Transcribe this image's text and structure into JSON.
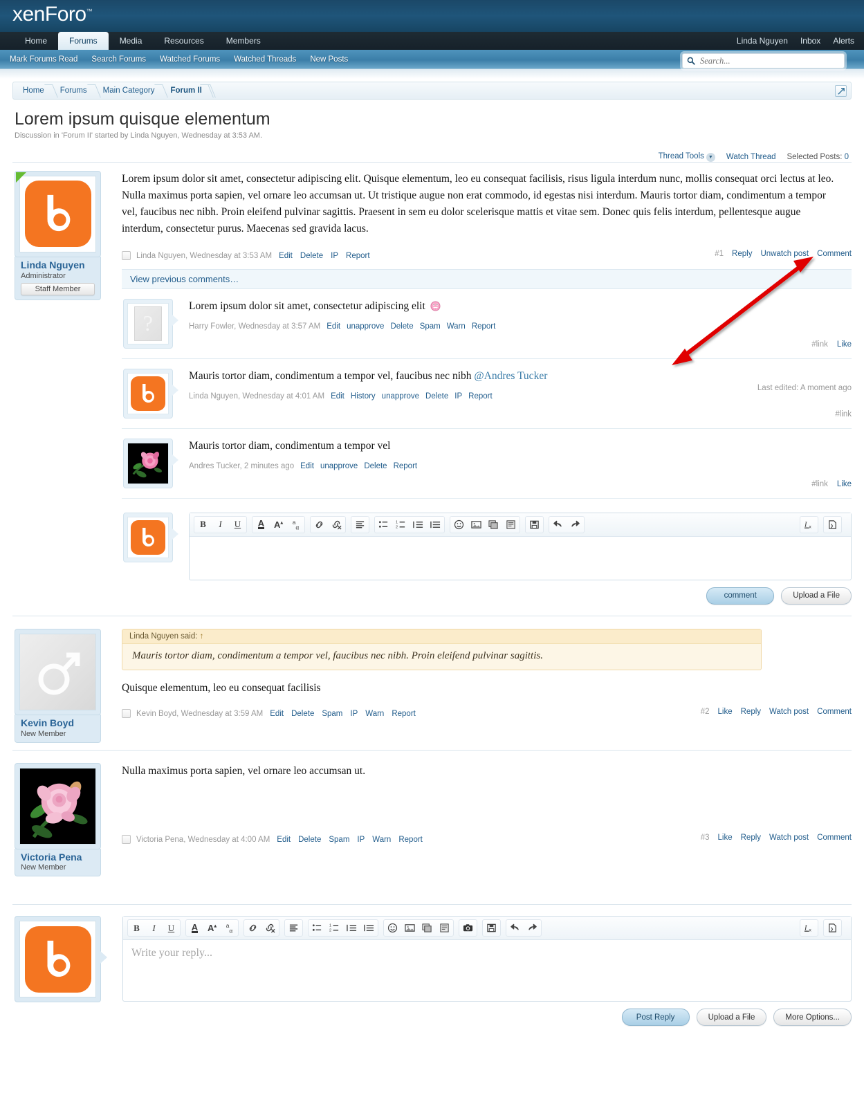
{
  "site": {
    "logo_text": "xenForo",
    "logo_tm": "™"
  },
  "nav": {
    "tabs": [
      {
        "label": "Home",
        "active": false
      },
      {
        "label": "Forums",
        "active": true
      },
      {
        "label": "Media",
        "active": false
      },
      {
        "label": "Resources",
        "active": false
      },
      {
        "label": "Members",
        "active": false
      }
    ],
    "right": [
      {
        "label": "Linda Nguyen"
      },
      {
        "label": "Inbox"
      },
      {
        "label": "Alerts"
      }
    ]
  },
  "subnav": {
    "items": [
      {
        "label": "Mark Forums Read"
      },
      {
        "label": "Search Forums"
      },
      {
        "label": "Watched Forums"
      },
      {
        "label": "Watched Threads"
      },
      {
        "label": "New Posts"
      }
    ],
    "search_placeholder": "Search..."
  },
  "breadcrumb": {
    "items": [
      {
        "label": "Home"
      },
      {
        "label": "Forums"
      },
      {
        "label": "Main Category"
      },
      {
        "label": "Forum II"
      }
    ]
  },
  "thread": {
    "title": "Lorem ipsum quisque elementum",
    "subtitle": "Discussion in 'Forum II' started by Linda Nguyen, Wednesday at 3:53 AM.",
    "tools": {
      "thread_tools": "Thread Tools",
      "watch_thread": "Watch Thread",
      "selected_posts_label": "Selected Posts:",
      "selected_posts_count": "0"
    }
  },
  "posts": [
    {
      "id": "post-1",
      "user": {
        "name": "Linda Nguyen",
        "title": "Administrator",
        "badge": "Staff Member",
        "avatar": "logo-b",
        "online": true
      },
      "body": "Lorem ipsum dolor sit amet, consectetur adipiscing elit. Quisque elementum, leo eu consequat facilisis, risus ligula interdum nunc, mollis consequat orci lectus at leo. Nulla maximus porta sapien, vel ornare leo accumsan ut. Ut tristique augue non erat commodo, id egestas nisi interdum. Mauris tortor diam, condimentum a tempor vel, faucibus nec nibh. Proin eleifend pulvinar sagittis. Praesent in sem eu dolor scelerisque mattis et vitae sem. Donec quis felis interdum, pellentesque augue interdum, consectetur purus. Maecenas sed gravida lacus.",
      "footer_meta": "Linda Nguyen, Wednesday at 3:53 AM",
      "footer_links": [
        "Edit",
        "Delete",
        "IP",
        "Report"
      ],
      "post_number": "#1",
      "right_links": [
        "Reply",
        "Unwatch post",
        "Comment"
      ]
    },
    {
      "id": "post-2",
      "user": {
        "name": "Kevin Boyd",
        "title": "New Member",
        "badge": null,
        "avatar": "gender-male",
        "online": false
      },
      "quote": {
        "header_name": "Linda Nguyen said:",
        "arrow": "↑",
        "text": "Mauris tortor diam, condimentum a tempor vel, faucibus nec nibh. Proin eleifend pulvinar sagittis."
      },
      "body": "Quisque elementum, leo eu consequat facilisis",
      "footer_meta": "Kevin Boyd, Wednesday at 3:59 AM",
      "footer_links": [
        "Edit",
        "Delete",
        "Spam",
        "IP",
        "Warn",
        "Report"
      ],
      "post_number": "#2",
      "right_links": [
        "Like",
        "Reply",
        "Watch post",
        "Comment"
      ]
    },
    {
      "id": "post-3",
      "user": {
        "name": "Victoria Pena",
        "title": "New Member",
        "badge": null,
        "avatar": "rose-photo",
        "online": false
      },
      "body": "Nulla maximus porta sapien, vel ornare leo accumsan ut.",
      "footer_meta": "Victoria Pena, Wednesday at 4:00 AM",
      "footer_links": [
        "Edit",
        "Delete",
        "Spam",
        "IP",
        "Warn",
        "Report"
      ],
      "post_number": "#3",
      "right_links": [
        "Like",
        "Reply",
        "Watch post",
        "Comment"
      ]
    }
  ],
  "comments": {
    "view_previous": "View previous comments…",
    "items": [
      {
        "avatar": "question-placeholder",
        "text": "Lorem ipsum dolor sit amet, consectetur adipiscing elit",
        "has_smiley": true,
        "meta": "Harry Fowler, Wednesday at 3:57 AM",
        "links": [
          "Edit",
          "unapprove",
          "Delete",
          "Spam",
          "Warn",
          "Report"
        ],
        "hash": "#link",
        "like": "Like",
        "last_edited": null
      },
      {
        "avatar": "logo-b",
        "text": "Mauris tortor diam, condimentum a tempor vel, faucibus nec nibh ",
        "mention": "@Andres Tucker",
        "has_smiley": false,
        "meta": "Linda Nguyen, Wednesday at 4:01 AM",
        "links": [
          "Edit",
          "History",
          "unapprove",
          "Delete",
          "IP",
          "Report"
        ],
        "hash": "#link",
        "like": null,
        "last_edited": "Last edited: A moment ago"
      },
      {
        "avatar": "rose-photo",
        "text": "Mauris tortor diam, condimentum a tempor vel",
        "has_smiley": false,
        "meta": "Andres Tucker, 2 minutes ago",
        "links": [
          "Edit",
          "unapprove",
          "Delete",
          "Report"
        ],
        "hash": "#link",
        "like": "Like",
        "last_edited": null
      }
    ]
  },
  "comment_editor": {
    "avatar": "logo-b",
    "placeholder": "",
    "buttons": [
      {
        "label": "comment",
        "primary": true
      },
      {
        "label": "Upload a File",
        "primary": false
      }
    ],
    "toolbar_groups": [
      {
        "icons": [
          "bold-icon",
          "italic-icon",
          "underline-icon"
        ]
      },
      {
        "icons": [
          "text-color-icon",
          "font-size-icon",
          "font-family-icon"
        ]
      },
      {
        "icons": [
          "link-icon",
          "unlink-icon"
        ]
      },
      {
        "icons": [
          "align-icon"
        ]
      },
      {
        "icons": [
          "bullet-list-icon",
          "numbered-list-icon",
          "outdent-icon",
          "indent-icon"
        ]
      },
      {
        "icons": [
          "smiley-icon",
          "image-icon",
          "media-icon",
          "quote-icon"
        ]
      },
      {
        "icons": [
          "draft-save-icon"
        ]
      },
      {
        "icons": [
          "undo-icon",
          "redo-icon"
        ]
      }
    ],
    "toolbar_right": [
      "remove-formatting-icon",
      "source-toggle-icon"
    ]
  },
  "reply_editor": {
    "avatar": "logo-b",
    "placeholder": "Write your reply...",
    "buttons": [
      {
        "label": "Post Reply",
        "primary": true
      },
      {
        "label": "Upload a File",
        "primary": false
      },
      {
        "label": "More Options...",
        "primary": false
      }
    ],
    "toolbar_groups": [
      {
        "icons": [
          "bold-icon",
          "italic-icon",
          "underline-icon"
        ]
      },
      {
        "icons": [
          "text-color-icon",
          "font-size-icon",
          "font-family-icon"
        ]
      },
      {
        "icons": [
          "link-icon",
          "unlink-icon"
        ]
      },
      {
        "icons": [
          "align-icon"
        ]
      },
      {
        "icons": [
          "bullet-list-icon",
          "numbered-list-icon",
          "outdent-icon",
          "indent-icon"
        ]
      },
      {
        "icons": [
          "smiley-icon",
          "image-icon",
          "media-icon",
          "quote-icon"
        ]
      },
      {
        "icons": [
          "camera-icon"
        ]
      },
      {
        "icons": [
          "draft-save-icon"
        ]
      },
      {
        "icons": [
          "undo-icon",
          "redo-icon"
        ]
      }
    ],
    "toolbar_right": [
      "remove-formatting-icon",
      "source-toggle-icon"
    ]
  },
  "annotation": {
    "color": "#e00000",
    "type": "double-headed-arrow"
  },
  "colors": {
    "header_blue": "#1f557a",
    "navbar_dark": "#1a2730",
    "subnav_blue": "#3b7ea8",
    "link_blue": "#225d8c",
    "avatar_orange": "#f47521",
    "quote_bg": "#fdf6e6",
    "annotation_red": "#e00000"
  }
}
